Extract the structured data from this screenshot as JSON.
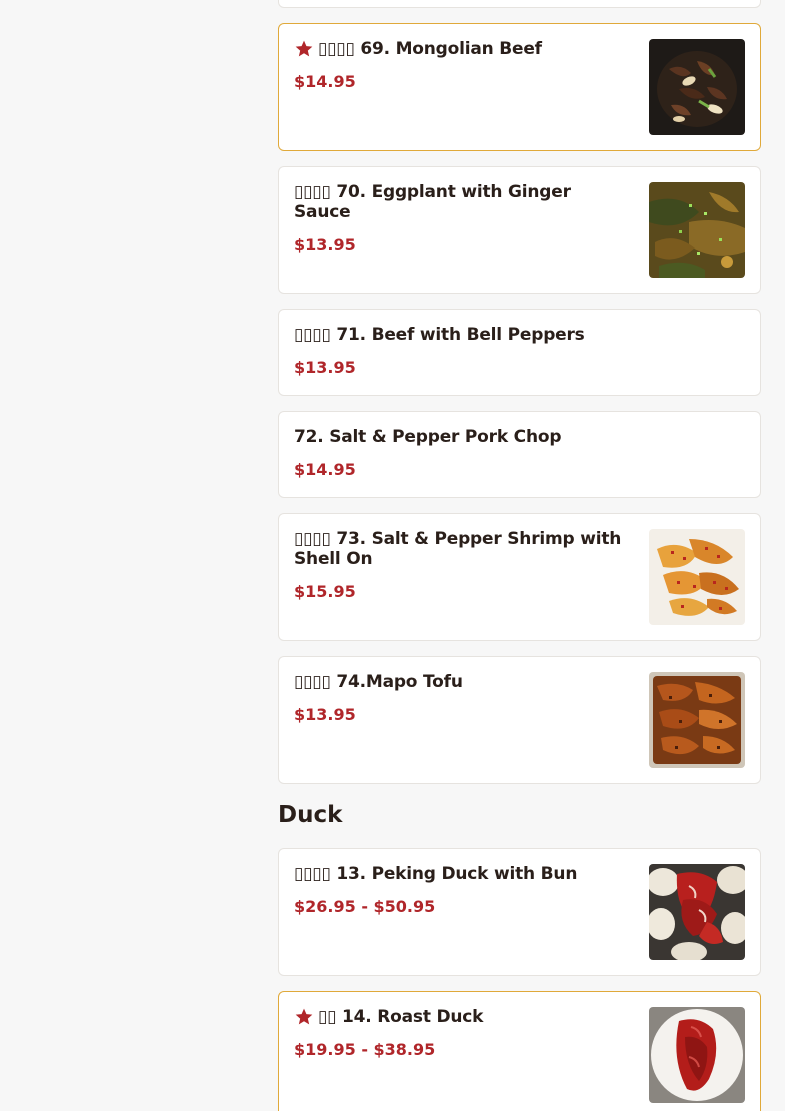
{
  "accent_color": "#b0262a",
  "featured_border_color": "#e0a93a",
  "items_top": [
    {
      "title": "▯▯▯▯ 69. Mongolian Beef",
      "price": "$14.95",
      "featured": true,
      "image": "mongolian-beef-photo"
    },
    {
      "title": "▯▯▯▯ 70. Eggplant with Ginger Sauce",
      "price": "$13.95",
      "featured": false,
      "image": "eggplant-photo"
    },
    {
      "title": "▯▯▯▯ 71. Beef with Bell Peppers",
      "price": "$13.95",
      "featured": false,
      "image": null
    },
    {
      "title": "72. Salt & Pepper Pork Chop",
      "price": "$14.95",
      "featured": false,
      "image": null
    },
    {
      "title": "▯▯▯▯ 73. Salt & Pepper Shrimp with Shell On",
      "price": "$15.95",
      "featured": false,
      "image": "shrimp-photo"
    },
    {
      "title": "▯▯▯▯ 74.Mapo Tofu",
      "price": "$13.95",
      "featured": false,
      "image": "mapo-tofu-photo"
    }
  ],
  "sections": [
    {
      "heading": "Duck"
    }
  ],
  "items_duck": [
    {
      "title": "▯▯▯▯ 13. Peking Duck with Bun",
      "price": "$26.95 - $50.95",
      "featured": false,
      "image": "peking-duck-photo"
    },
    {
      "title": "▯▯ 14. Roast Duck",
      "price": "$19.95 - $38.95",
      "featured": true,
      "image": "roast-duck-photo"
    }
  ],
  "icons": {
    "featured": "star-icon"
  }
}
